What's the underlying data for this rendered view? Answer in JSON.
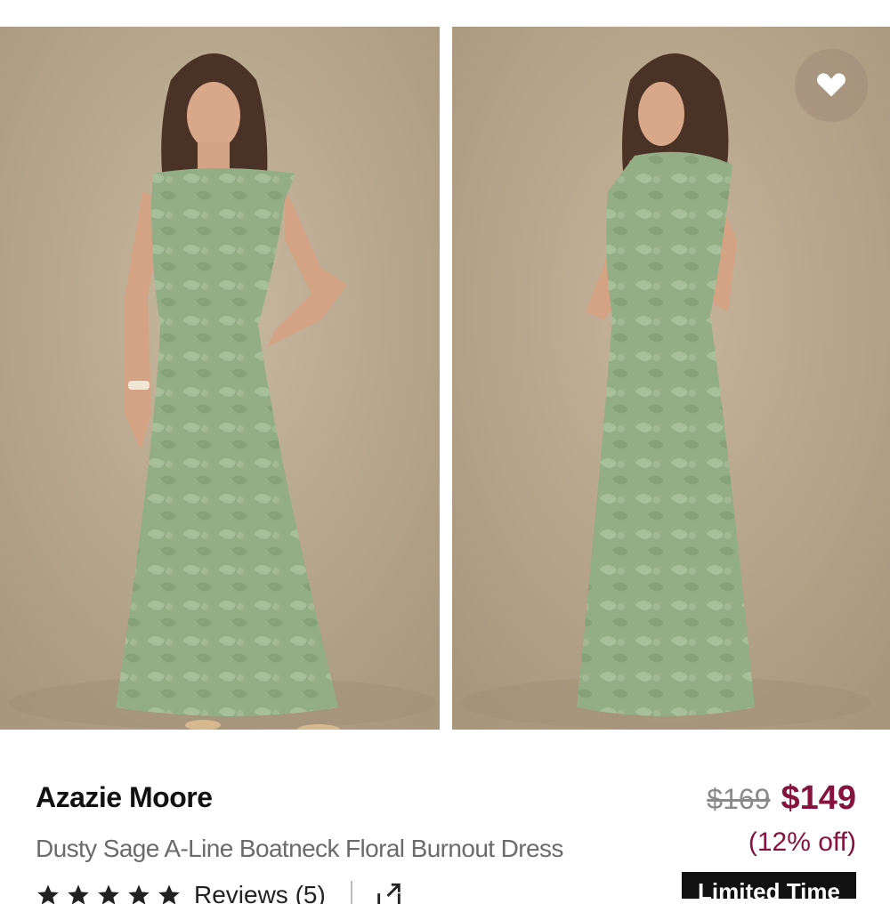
{
  "product": {
    "brand": "Azazie Moore",
    "name": "Dusty Sage A-Line Boatneck Floral Burnout Dress",
    "original_price": "$169",
    "sale_price": "$149",
    "discount": "(12% off)",
    "badge": "Limited Time",
    "rating_stars": 5,
    "reviews_label": "Reviews (5)"
  },
  "gallery": {
    "images": [
      {
        "name": "front-view-photo",
        "view": "front"
      },
      {
        "name": "back-view-photo",
        "view": "back"
      }
    ],
    "favorite_icon": "heart-icon"
  },
  "icons": {
    "star": "star-icon",
    "share": "share-icon"
  },
  "colors": {
    "accent": "#86133d",
    "dress": "#93ad86",
    "backdrop": "#b5a48c",
    "badge_bg": "#111111"
  }
}
